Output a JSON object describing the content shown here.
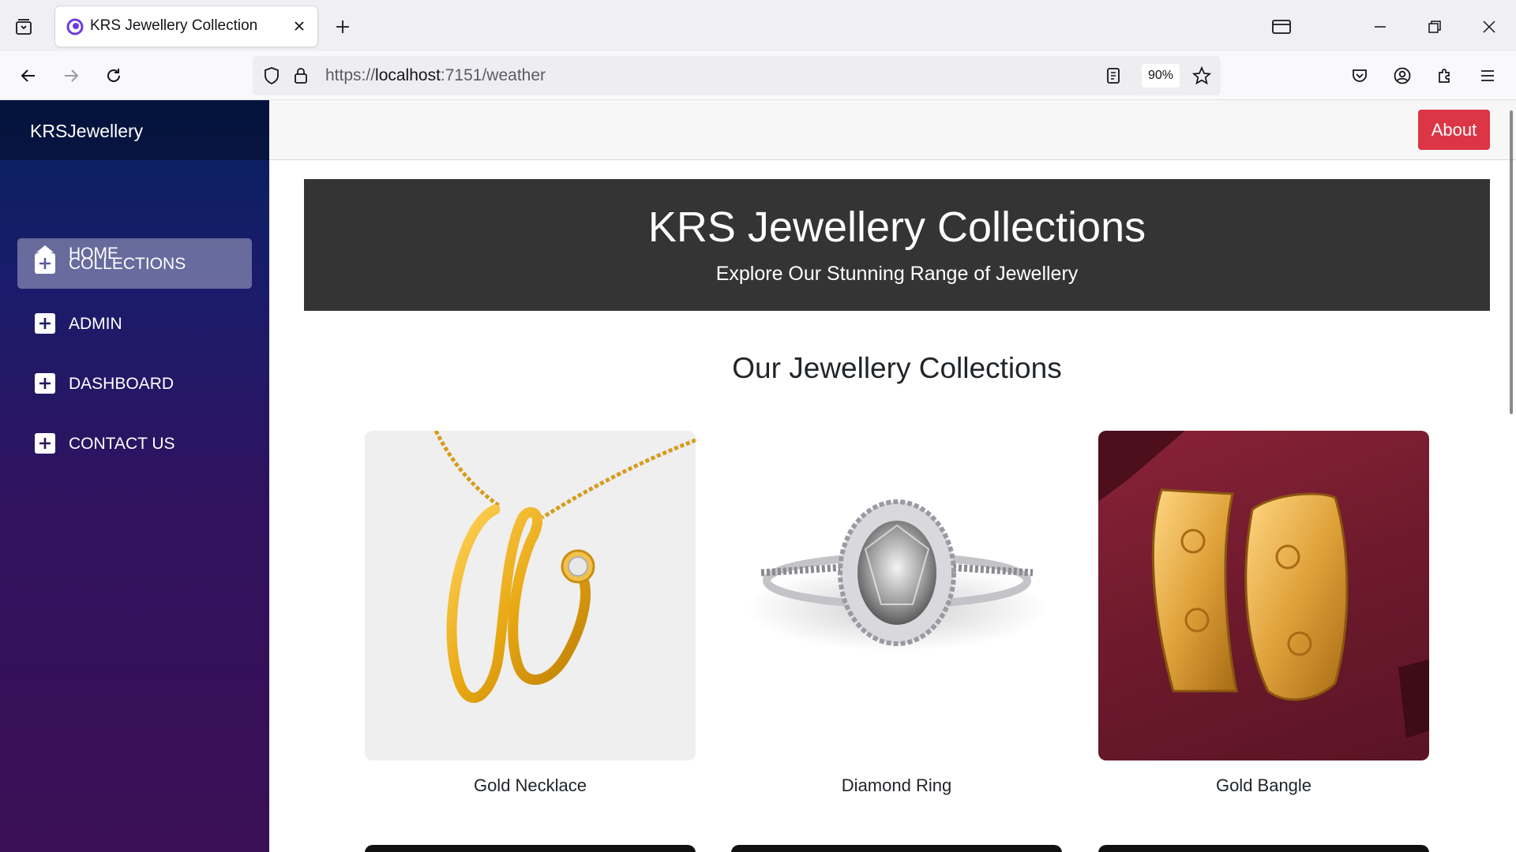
{
  "browser": {
    "tab_title": "KRS Jewellery Collection",
    "url_prefix": "https://",
    "url_host": "localhost",
    "url_rest": ":7151/weather",
    "zoom": "90%"
  },
  "sidebar": {
    "brand": "KRSJewellery",
    "items": [
      {
        "label": "HOME",
        "icon": "home-icon",
        "active": false
      },
      {
        "label": "COLLECTIONS",
        "icon": "plus-square-icon",
        "active": true
      },
      {
        "label": "ADMIN",
        "icon": "plus-square-icon",
        "active": false
      },
      {
        "label": "DASHBOARD",
        "icon": "plus-square-icon",
        "active": false
      },
      {
        "label": "CONTACT US",
        "icon": "plus-square-icon",
        "active": false
      }
    ]
  },
  "topbar": {
    "about_label": "About"
  },
  "hero": {
    "title": "KRS Jewellery Collections",
    "subtitle": "Explore Our Stunning Range of Jewellery"
  },
  "collections": {
    "heading": "Our Jewellery Collections",
    "items": [
      {
        "name": "Gold Necklace",
        "image": "gold-necklace-image"
      },
      {
        "name": "Diamond Ring",
        "image": "diamond-ring-image"
      },
      {
        "name": "Gold Bangle",
        "image": "gold-bangle-image"
      }
    ]
  },
  "colors": {
    "sidebar_top": "#06205e",
    "sidebar_bottom": "#3a0f55",
    "hero_bg": "#343434",
    "about_button": "#dc3545"
  }
}
